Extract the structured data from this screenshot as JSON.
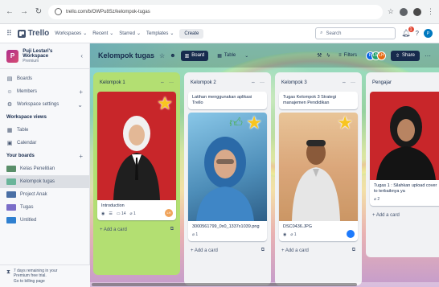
{
  "browser": {
    "url": "trello.com/b/OWPu8Sz/kelompok-tugas"
  },
  "header": {
    "logo": "Trello",
    "menus": [
      "Workspaces",
      "Recent",
      "Starred",
      "Templates"
    ],
    "create_label": "Create",
    "search_placeholder": "Search",
    "notification_count": "1"
  },
  "sidebar": {
    "workspace_name": "Puji Lestari's Workspace",
    "workspace_plan": "Premium",
    "workspace_initial": "P",
    "items": [
      {
        "label": "Boards",
        "icon": "board-icon"
      },
      {
        "label": "Members",
        "icon": "members-icon"
      },
      {
        "label": "Workspace settings",
        "icon": "settings-icon"
      }
    ],
    "views_heading": "Workspace views",
    "views": [
      {
        "label": "Table",
        "icon": "table-icon"
      },
      {
        "label": "Calendar",
        "icon": "calendar-icon"
      }
    ],
    "boards_heading": "Your boards",
    "boards": [
      {
        "label": "Kelas Penelitian",
        "color": "#5a8f6a"
      },
      {
        "label": "Kelompok tugas",
        "color": "#6ab59a"
      },
      {
        "label": "Project Anak",
        "color": "#4a6fa5"
      },
      {
        "label": "Tugas",
        "color": "#7a6dc8"
      },
      {
        "label": "Untitled",
        "color": "#2f80d0"
      }
    ],
    "trial_text_1": "7 days remaining in your",
    "trial_text_2": "Premium free trial.",
    "trial_text_3": "Go to billing page"
  },
  "board": {
    "title": "Kelompok tugas",
    "view_board": "Board",
    "view_table": "Table",
    "filters_label": "Filters",
    "share_label": "Share",
    "members": [
      {
        "initials": "P",
        "color": "#0c66e4"
      },
      {
        "initials": "LM",
        "color": "#22a06b"
      },
      {
        "initials": "LH",
        "color": "#e56910"
      }
    ]
  },
  "lists": [
    {
      "title": "Kelompok 1",
      "card_title": "Introduction",
      "badge_comments": "14",
      "badge_attachments": "1",
      "member": "LH",
      "add_label": "+ Add a card"
    },
    {
      "title": "Kelompok 2",
      "card_top": "Latihan menggunakan aplikasi Trello",
      "card_title": "3000561799_0x0_1337x1039.png",
      "badge_attachments": "1",
      "add_label": "+ Add a card"
    },
    {
      "title": "Kelompok 3",
      "card_top": "Tugas Kelompok 3 Strategi manajemen Pendidikan",
      "card_title": "DSC0436.JPG",
      "badge_attachments": "1",
      "add_label": "+ Add a card"
    },
    {
      "title": "Pengajar",
      "card_title": "Tugas 1 : Silahkan upload cover to terbaiknya ya",
      "badge_attachments": "2",
      "add_label": "+ Add a card"
    }
  ]
}
